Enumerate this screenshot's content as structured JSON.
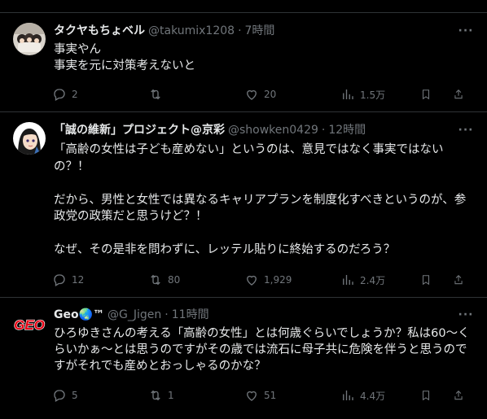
{
  "tweets": [
    {
      "display_name": "タクヤもちょベル",
      "handle": "@takumix1208",
      "time": "7時間",
      "text": "事実やん\n事実を元に対策考えないと",
      "replies": "2",
      "retweets": "",
      "likes": "20",
      "views": "1.5万",
      "more": "···"
    },
    {
      "display_name": "「誠の維新」プロジェクト@京彩",
      "handle": "@showken0429",
      "time": "12時間",
      "text": "「高齢の女性は子ども産めない」というのは、意見ではなく事実ではないの？！\n\nだから、男性と女性では異なるキャリアプランを制度化すべきというのが、参政党の政策だと思うけど？！\n\nなぜ、その是非を問わずに、レッテル貼りに終始するのだろう？",
      "replies": "12",
      "retweets": "80",
      "likes": "1,929",
      "views": "2.4万",
      "more": "···"
    },
    {
      "display_name": "Geo🌏™",
      "handle": "@G_Jigen",
      "time": "11時間",
      "text": "ひろゆきさんの考える「高齢の女性」とは何歳ぐらいでしょうか？私は60〜くらいかぁ～とは思うのですがその歳では流石に母子共に危険を伴うと思うのですがそれでも産めとおっしゃるのかな？",
      "replies": "5",
      "retweets": "1",
      "likes": "51",
      "views": "4.4万",
      "more": "···",
      "avatar_logo": "GEO"
    }
  ],
  "separator": "·",
  "colors": {
    "background": "#000000",
    "text": "#e7e9ea",
    "muted": "#71767b",
    "border": "#2f3336",
    "geo_red": "#e60012"
  },
  "icons": [
    "reply-icon",
    "retweet-icon",
    "like-icon",
    "views-icon",
    "bookmark-icon",
    "share-icon",
    "more-icon"
  ]
}
